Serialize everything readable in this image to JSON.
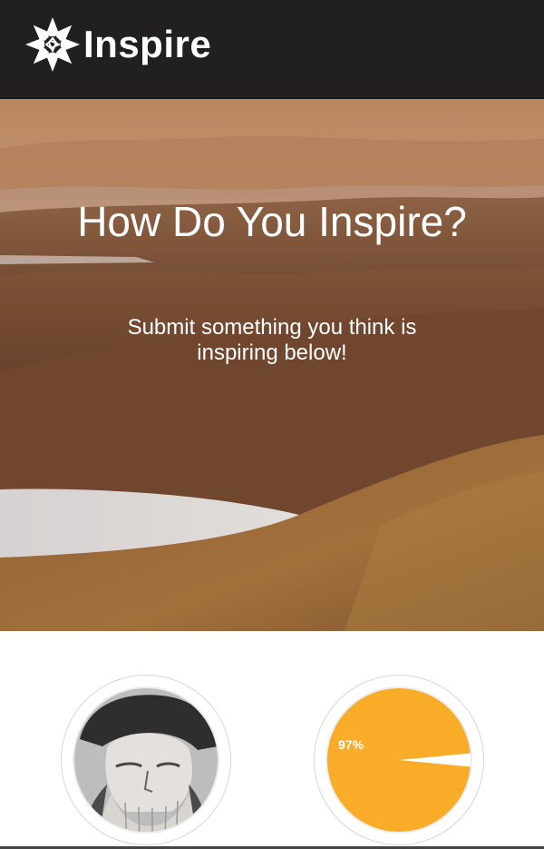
{
  "header": {
    "brand": "Inspire",
    "logo_icon": "flower-star-icon",
    "background": "#221f20"
  },
  "hero": {
    "title": "How Do You Inspire?",
    "subtitle": "Submit something you think is inspiring below!",
    "image": "landscape-hills-lake"
  },
  "cards": [
    {
      "kind": "portrait",
      "image": "portrait-engraving-bearded-man"
    },
    {
      "kind": "pie-chart",
      "label": "97%",
      "color": "#f8ac27"
    }
  ],
  "chart_data": {
    "type": "pie",
    "values": [
      97,
      3
    ],
    "labels": [
      "97%",
      ""
    ],
    "colors": [
      "#f8ac27",
      "#ffffff"
    ]
  }
}
